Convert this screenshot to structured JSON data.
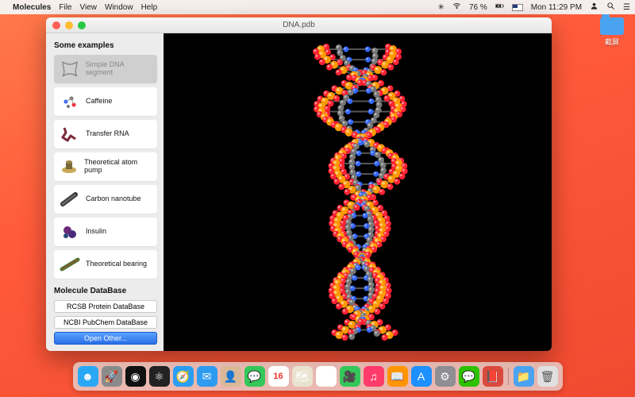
{
  "menubar": {
    "app_name": "Molecules",
    "items": [
      "File",
      "View",
      "Window",
      "Help"
    ],
    "battery": "76 %",
    "clock": "Mon 11:29 PM"
  },
  "window": {
    "title": "DNA.pdb"
  },
  "sidebar": {
    "examples_title": "Some examples",
    "items": [
      {
        "label": "Simple DNA segment",
        "selected": true
      },
      {
        "label": "Caffeine",
        "selected": false
      },
      {
        "label": "Transfer RNA",
        "selected": false
      },
      {
        "label": "Theoretical atom pump",
        "selected": false
      },
      {
        "label": "Carbon nanotube",
        "selected": false
      },
      {
        "label": "Insulin",
        "selected": false
      },
      {
        "label": "Theoretical bearing",
        "selected": false
      }
    ],
    "db_title": "Molecule DataBase",
    "db_buttons": [
      "RCSB Protein DataBase",
      "NCBI PubChem DataBase"
    ],
    "open_other": "Open Other..."
  },
  "desktop": {
    "folder_label": "截屏"
  },
  "dock": {
    "items": [
      {
        "name": "finder",
        "bg": "#2aa8f5"
      },
      {
        "name": "launchpad",
        "bg": "#8a8a8a"
      },
      {
        "name": "siri",
        "bg": "#111"
      },
      {
        "name": "molecules",
        "bg": "#222"
      },
      {
        "name": "safari",
        "bg": "#2a9df4"
      },
      {
        "name": "mail",
        "bg": "#2d9bf0"
      },
      {
        "name": "contacts",
        "bg": "#d9b897"
      },
      {
        "name": "messages",
        "bg": "#34c759"
      },
      {
        "name": "calendar",
        "bg": "#fff"
      },
      {
        "name": "maps",
        "bg": "#e8e2ce"
      },
      {
        "name": "photos",
        "bg": "#fff"
      },
      {
        "name": "facetime",
        "bg": "#34c759"
      },
      {
        "name": "itunes",
        "bg": "#ff3b6b"
      },
      {
        "name": "ibooks",
        "bg": "#ff9500"
      },
      {
        "name": "appstore",
        "bg": "#1e90ff"
      },
      {
        "name": "preferences",
        "bg": "#8e8e93"
      },
      {
        "name": "wechat",
        "bg": "#2dc100"
      },
      {
        "name": "dictionary",
        "bg": "#d94a3d"
      }
    ],
    "recent": [
      {
        "name": "screenshots-folder",
        "bg": "#4aa3f0"
      },
      {
        "name": "trash",
        "bg": "#e0e0e0"
      }
    ]
  },
  "molecule_colors": {
    "carbon": "#777",
    "oxygen": "#f23",
    "nitrogen": "#36f",
    "phosphorus": "#f90",
    "hydrogen": "#ddd"
  }
}
